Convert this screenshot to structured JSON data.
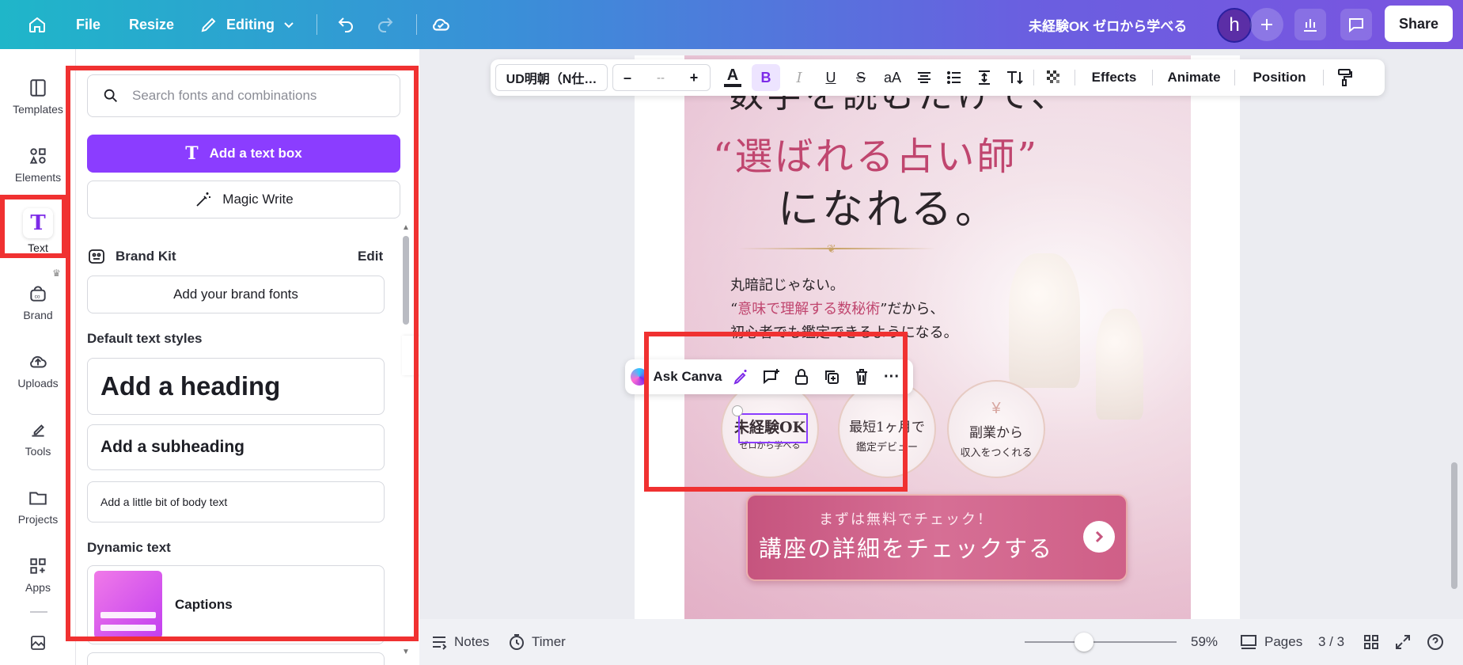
{
  "topbar": {
    "file_label": "File",
    "resize_label": "Resize",
    "editing_label": "Editing",
    "doc_title": "未経験OK ゼロから学べる",
    "avatar_initial": "h",
    "share_label": "Share"
  },
  "rail": {
    "items": [
      {
        "label": "Templates",
        "icon": "templates-icon"
      },
      {
        "label": "Elements",
        "icon": "elements-icon"
      },
      {
        "label": "Text",
        "icon": "text-icon"
      },
      {
        "label": "Brand",
        "icon": "brand-icon"
      },
      {
        "label": "Uploads",
        "icon": "uploads-icon"
      },
      {
        "label": "Tools",
        "icon": "tools-icon"
      },
      {
        "label": "Projects",
        "icon": "projects-icon"
      },
      {
        "label": "Apps",
        "icon": "apps-icon"
      }
    ]
  },
  "panel": {
    "search_placeholder": "Search fonts and combinations",
    "add_text_box": "Add a text box",
    "magic_write": "Magic Write",
    "brand_kit_label": "Brand Kit",
    "brand_kit_edit": "Edit",
    "add_brand_fonts": "Add your brand fonts",
    "default_styles_label": "Default text styles",
    "heading": "Add a heading",
    "subheading": "Add a subheading",
    "body": "Add a little bit of body text",
    "dynamic_label": "Dynamic text",
    "captions": "Captions"
  },
  "texttoolbar": {
    "font_name": "UD明朝（N仕…",
    "size_minus": "–",
    "size_value": "--",
    "size_plus": "+",
    "bold": "B",
    "italic": "I",
    "underline": "U",
    "strike": "S",
    "case": "aA",
    "effects": "Effects",
    "animate": "Animate",
    "position": "Position"
  },
  "design": {
    "line1": "数字を読むだけで、",
    "line2": "“選ばれる占い師”",
    "line3": "になれる。",
    "para1": "丸暗記じゃない。",
    "para2_quote_open": "“",
    "para2_pink": "意味で理解する数秘術",
    "para2_rest": "”だから、",
    "para3": "初心者でも鑑定できるようになる。",
    "badge1_top": "未経験OK",
    "badge1_bottom": "ゼロから学べる",
    "badge2_top": "最短1ヶ月で",
    "badge2_bottom": "鑑定デビュー",
    "badge3_top": "副業から",
    "badge3_bottom": "収入をつくれる",
    "cta_small": "まずは無料でチェック！",
    "cta_big": "講座の詳細をチェックする"
  },
  "ctxbar": {
    "ask_canva": "Ask Canva"
  },
  "bottombar": {
    "notes": "Notes",
    "timer": "Timer",
    "zoom": "59%",
    "zoom_level": 0.39,
    "pages": "Pages",
    "page_count": "3 / 3"
  },
  "colors": {
    "accent": "#7d2ae8",
    "highlight_red": "#f03131",
    "pink_text": "#c0466f"
  }
}
